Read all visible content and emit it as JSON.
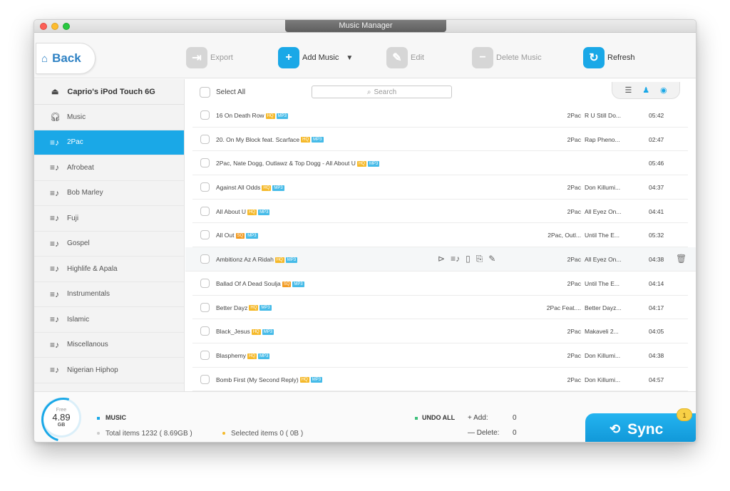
{
  "window": {
    "title": "Music Manager"
  },
  "toolbar": {
    "back": "Back",
    "export": "Export",
    "add_music": "Add Music",
    "edit": "Edit",
    "delete_music": "Delete Music",
    "refresh": "Refresh"
  },
  "sidebar": {
    "device": "Caprio's iPod Touch 6G",
    "items": [
      {
        "label": "Music",
        "icon": "headphones-icon"
      },
      {
        "label": "2Pac",
        "icon": "playlist-icon"
      },
      {
        "label": "Afrobeat",
        "icon": "playlist-icon"
      },
      {
        "label": "Bob Marley",
        "icon": "playlist-icon"
      },
      {
        "label": "Fuji",
        "icon": "playlist-icon"
      },
      {
        "label": "Gospel",
        "icon": "playlist-icon"
      },
      {
        "label": "Highlife & Apala",
        "icon": "playlist-icon"
      },
      {
        "label": "Instrumentals",
        "icon": "playlist-icon"
      },
      {
        "label": "Islamic",
        "icon": "playlist-icon"
      },
      {
        "label": "Miscellanous",
        "icon": "playlist-icon"
      },
      {
        "label": "Nigerian Hiphop",
        "icon": "playlist-icon"
      }
    ]
  },
  "list": {
    "select_all": "Select All",
    "search_placeholder": "Search",
    "rows": [
      {
        "name": "16 On Death Row",
        "quality": "HQ",
        "format": "MP3",
        "artist": "2Pac",
        "album": "R U Still Do...",
        "time": "05:42"
      },
      {
        "name": "20.   On My Block feat. Scarface",
        "quality": "HQ",
        "format": "MP3",
        "artist": "2Pac",
        "album": "Rap Pheno...",
        "time": "02:47"
      },
      {
        "name": "2Pac, Nate Dogg, Outlawz & Top Dogg - All About U",
        "quality": "HQ",
        "format": "MP3",
        "artist": "",
        "album": "",
        "time": "05:46"
      },
      {
        "name": "Against All Odds",
        "quality": "HQ",
        "format": "MP3",
        "artist": "2Pac",
        "album": "Don Killumi...",
        "time": "04:37"
      },
      {
        "name": "All About U",
        "quality": "HQ",
        "format": "MP3",
        "artist": "2Pac",
        "album": "All Eyez On...",
        "time": "04:41"
      },
      {
        "name": "All Out",
        "quality": "SQ",
        "format": "MP3",
        "artist": "2Pac, Outl...",
        "album": "Until The E...",
        "time": "05:32"
      },
      {
        "name": "Ambitionz Az A Ridah",
        "quality": "HQ",
        "format": "MP3",
        "artist": "2Pac",
        "album": "All Eyez On...",
        "time": "04:38"
      },
      {
        "name": "Ballad Of A Dead Soulja",
        "quality": "SQ",
        "format": "MP3",
        "artist": "2Pac",
        "album": "Until The E...",
        "time": "04:14"
      },
      {
        "name": "Better Dayz",
        "quality": "HQ",
        "format": "MP3",
        "artist": "2Pac Feat....",
        "album": "Better Dayz...",
        "time": "04:17"
      },
      {
        "name": "Black_Jesus",
        "quality": "HQ",
        "format": "MP3",
        "artist": "2Pac",
        "album": "Makaveli 2...",
        "time": "04:05"
      },
      {
        "name": "Blasphemy",
        "quality": "HQ",
        "format": "MP3",
        "artist": "2Pac",
        "album": "Don Killumi...",
        "time": "04:38"
      },
      {
        "name": "Bomb First (My Second Reply)",
        "quality": "HQ",
        "format": "MP3",
        "artist": "2Pac",
        "album": "Don Killumi...",
        "time": "04:57"
      }
    ]
  },
  "footer": {
    "free_label": "Free",
    "free_value": "4.89",
    "free_unit": "GB",
    "music_label": "MUSIC",
    "total_items": "Total items 1232 ( 8.69GB )",
    "selected_items": "Selected items 0 ( 0B )",
    "undo_all": "UNDO ALL",
    "add_label": "+ Add:",
    "add_value": "0",
    "delete_label": "— Delete:",
    "delete_value": "0",
    "sync": "Sync",
    "sync_badge": "1"
  },
  "colors": {
    "accent": "#1aa8e7",
    "hq_badge": "#f5b92a",
    "sq_badge": "#f29b22",
    "format_badge": "#46bbe8"
  }
}
